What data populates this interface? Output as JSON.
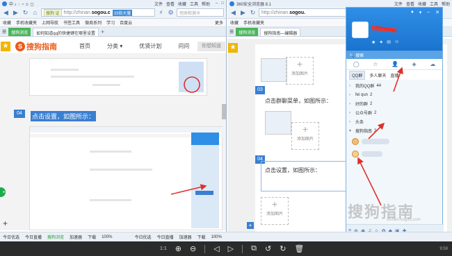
{
  "left_browser": {
    "title_menu": [
      "文件",
      "查看",
      "收藏",
      "工具",
      "帮助"
    ],
    "url_secure": "搜狗 证",
    "url_dim": "http://zhinan.",
    "url_host": "sogou.c",
    "url_badge": "33倍大量",
    "search_placeholder": "司命检测卡",
    "favorites": [
      "收藏",
      "手机收藏夹",
      "上网导航",
      "书签工具",
      "微商系列",
      "学习",
      "百度云"
    ],
    "favorites_more": "更多",
    "tabs": [
      "搜狗浏览",
      "如何知道qq的快捷键在哪里设置"
    ],
    "header": {
      "logo_text": "搜狗指南",
      "nav": [
        "首页",
        "分类",
        "优贤计划",
        "问问"
      ],
      "login": "你想知道"
    },
    "step_number": "04",
    "step_text": "点击设置，如图所示："
  },
  "right_browser": {
    "title": "360安全浏览器 8.1",
    "title_menu": [
      "文件",
      "查看",
      "收藏",
      "工具",
      "帮助"
    ],
    "url_dim": "http://zhinan.",
    "url_host": "sogou.",
    "favorites": [
      "收藏",
      "手机收藏夹"
    ],
    "tabs": [
      "搜狗浏览",
      "搜狗指南—编辑器"
    ],
    "add_image_label": "添加图片",
    "steps": [
      {
        "num": "03",
        "text": "点击群聊菜单，如图所示："
      },
      {
        "num": "04",
        "text": "点击设置，如图所示："
      }
    ]
  },
  "qq_panel": {
    "search_placeholder": "搜索",
    "tabs": [
      "QQ群",
      "多人聊天",
      "直播"
    ],
    "groups": [
      {
        "name": "我的QQ群",
        "count": "44"
      },
      {
        "name": "fei qun",
        "count": "2"
      },
      {
        "name": "好的群",
        "count": "2"
      },
      {
        "name": "公众号群",
        "count": "2"
      },
      {
        "name": "头条",
        "count": ""
      },
      {
        "name": "搜狗指南",
        "count": "2"
      }
    ]
  },
  "watermark": {
    "text": "搜狗指南",
    "url": "zhinan.sogou.com"
  },
  "status_bar": {
    "left_items": [
      "今日优选",
      "今日直播",
      "搜狗浏览",
      "加速器",
      "下载",
      "100%"
    ],
    "right_items": [
      "今日优选",
      "今日直播",
      "加速器",
      "下载",
      "100%"
    ]
  },
  "taskbar": {
    "zoom": "1:1",
    "clock": "9:59"
  },
  "colors": {
    "sogou_orange": "#ea5b1a",
    "step_blue": "#3a7fd0",
    "qq_blue": "#1a74cf",
    "arrow_red": "#e0302a"
  }
}
